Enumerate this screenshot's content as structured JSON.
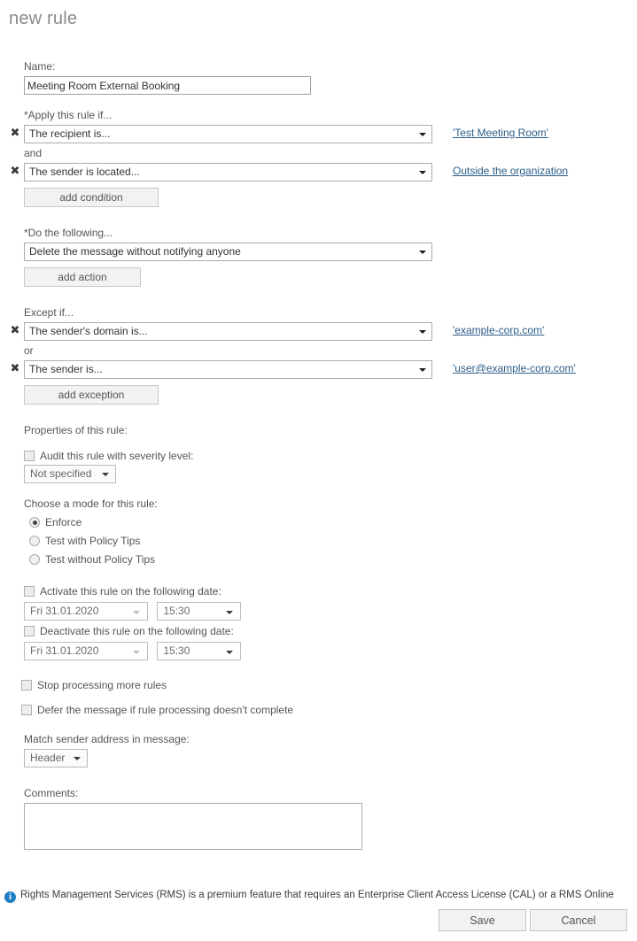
{
  "page": {
    "title": "new rule"
  },
  "name_field": {
    "label": "Name:",
    "value": "Meeting Room External Booking",
    "placeholder": ""
  },
  "conditions": {
    "section_label": "*Apply this rule if...",
    "rows": [
      {
        "remove_icon": "✖",
        "select_value": "The recipient is...",
        "link": "'Test Meeting Room'",
        "conjunction_before": null
      },
      {
        "remove_icon": "✖",
        "select_value": "The sender is located...",
        "link": "Outside the organization",
        "conjunction_before": "and"
      }
    ],
    "add_button": "add condition"
  },
  "actions": {
    "section_label": "*Do the following...",
    "rows": [
      {
        "select_value": "Delete the message without notifying anyone"
      }
    ],
    "add_button": "add action"
  },
  "exceptions": {
    "section_label": "Except if...",
    "rows": [
      {
        "remove_icon": "✖",
        "select_value": "The sender's domain is...",
        "link": "'example-corp.com'",
        "conjunction_before": null
      },
      {
        "remove_icon": "✖",
        "select_value": "The sender is...",
        "link": "'user@example-corp.com'",
        "conjunction_before": "or"
      }
    ],
    "add_button": "add exception"
  },
  "properties": {
    "section_label": "Properties of this rule:",
    "audit": {
      "checkbox_label": "Audit this rule with severity level:",
      "checked": false,
      "severity_value": "Not specified"
    },
    "mode": {
      "label": "Choose a mode for this rule:",
      "options": [
        {
          "label": "Enforce",
          "selected": true
        },
        {
          "label": "Test with Policy Tips",
          "selected": false
        },
        {
          "label": "Test without Policy Tips",
          "selected": false
        }
      ]
    },
    "activate": {
      "checkbox_label": "Activate this rule on the following date:",
      "checked": false,
      "date_value": "Fri 31.01.2020",
      "time_value": "15:30"
    },
    "deactivate": {
      "checkbox_label": "Deactivate this rule on the following date:",
      "checked": false,
      "date_value": "Fri 31.01.2020",
      "time_value": "15:30"
    },
    "stop_processing": {
      "checkbox_label": "Stop processing more rules",
      "checked": false
    },
    "defer_message": {
      "checkbox_label": "Defer the message if rule processing doesn't complete",
      "checked": false
    },
    "match_sender": {
      "label": "Match sender address in message:",
      "value": "Header"
    }
  },
  "comments": {
    "label": "Comments:",
    "value": "",
    "placeholder": ""
  },
  "footer": {
    "info_icon_glyph": "i",
    "note": "Rights Management Services (RMS) is a premium feature that requires an Enterprise Client Access License (CAL) or a RMS Online",
    "save_label": "Save",
    "cancel_label": "Cancel"
  },
  "colors": {
    "link": "#2c5d87",
    "info_icon": "#1e7fc4",
    "title": "#8a8a8a"
  }
}
